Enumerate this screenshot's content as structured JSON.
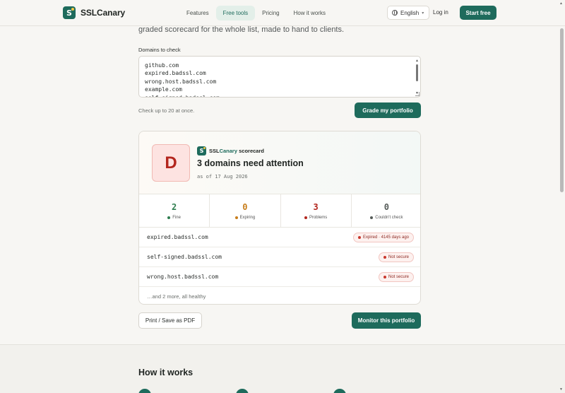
{
  "header": {
    "brand": "SSLCanary",
    "logo_letter": "S",
    "nav": [
      "Features",
      "Free tools",
      "Pricing",
      "How it works"
    ],
    "active_nav": "Free tools",
    "language": "English",
    "login": "Log in",
    "start": "Start free"
  },
  "hero": {
    "subtitle": "graded scorecard for the whole list, made to hand to clients.",
    "field_label": "Domains to check",
    "textarea_value": "github.com\nexpired.badssl.com\nwrong.host.badssl.com\nexample.com\nself-signed.badssl.com",
    "hint": "Check up to 20 at once.",
    "grade_button": "Grade my portfolio"
  },
  "scorecard": {
    "grade": "D",
    "brand_prefix": "SSL",
    "brand_accent": "Canary",
    "brand_suffix": " scorecard",
    "headline": "3 domains need attention",
    "as_of": "as of 17 Aug 2026",
    "stats": [
      {
        "value": "2",
        "label": "Fine",
        "color": "#2e7d4f"
      },
      {
        "value": "0",
        "label": "Expiring",
        "color": "#c77d1a"
      },
      {
        "value": "3",
        "label": "Problems",
        "color": "#b3261e"
      },
      {
        "value": "0",
        "label": "Couldn't check",
        "color": "#555b58"
      }
    ],
    "rows": [
      {
        "domain": "expired.badssl.com",
        "status": "Expired · 4145 days ago"
      },
      {
        "domain": "self-signed.badssl.com",
        "status": "Not secure"
      },
      {
        "domain": "wrong.host.badssl.com",
        "status": "Not secure"
      }
    ],
    "more": "…and 2 more, all healthy"
  },
  "actions": {
    "print": "Print / Save as PDF",
    "monitor": "Monitor this portfolio"
  },
  "how_it_works": {
    "title": "How it works"
  },
  "colors": {
    "brand": "#1e6b5c",
    "danger": "#b3261e"
  }
}
